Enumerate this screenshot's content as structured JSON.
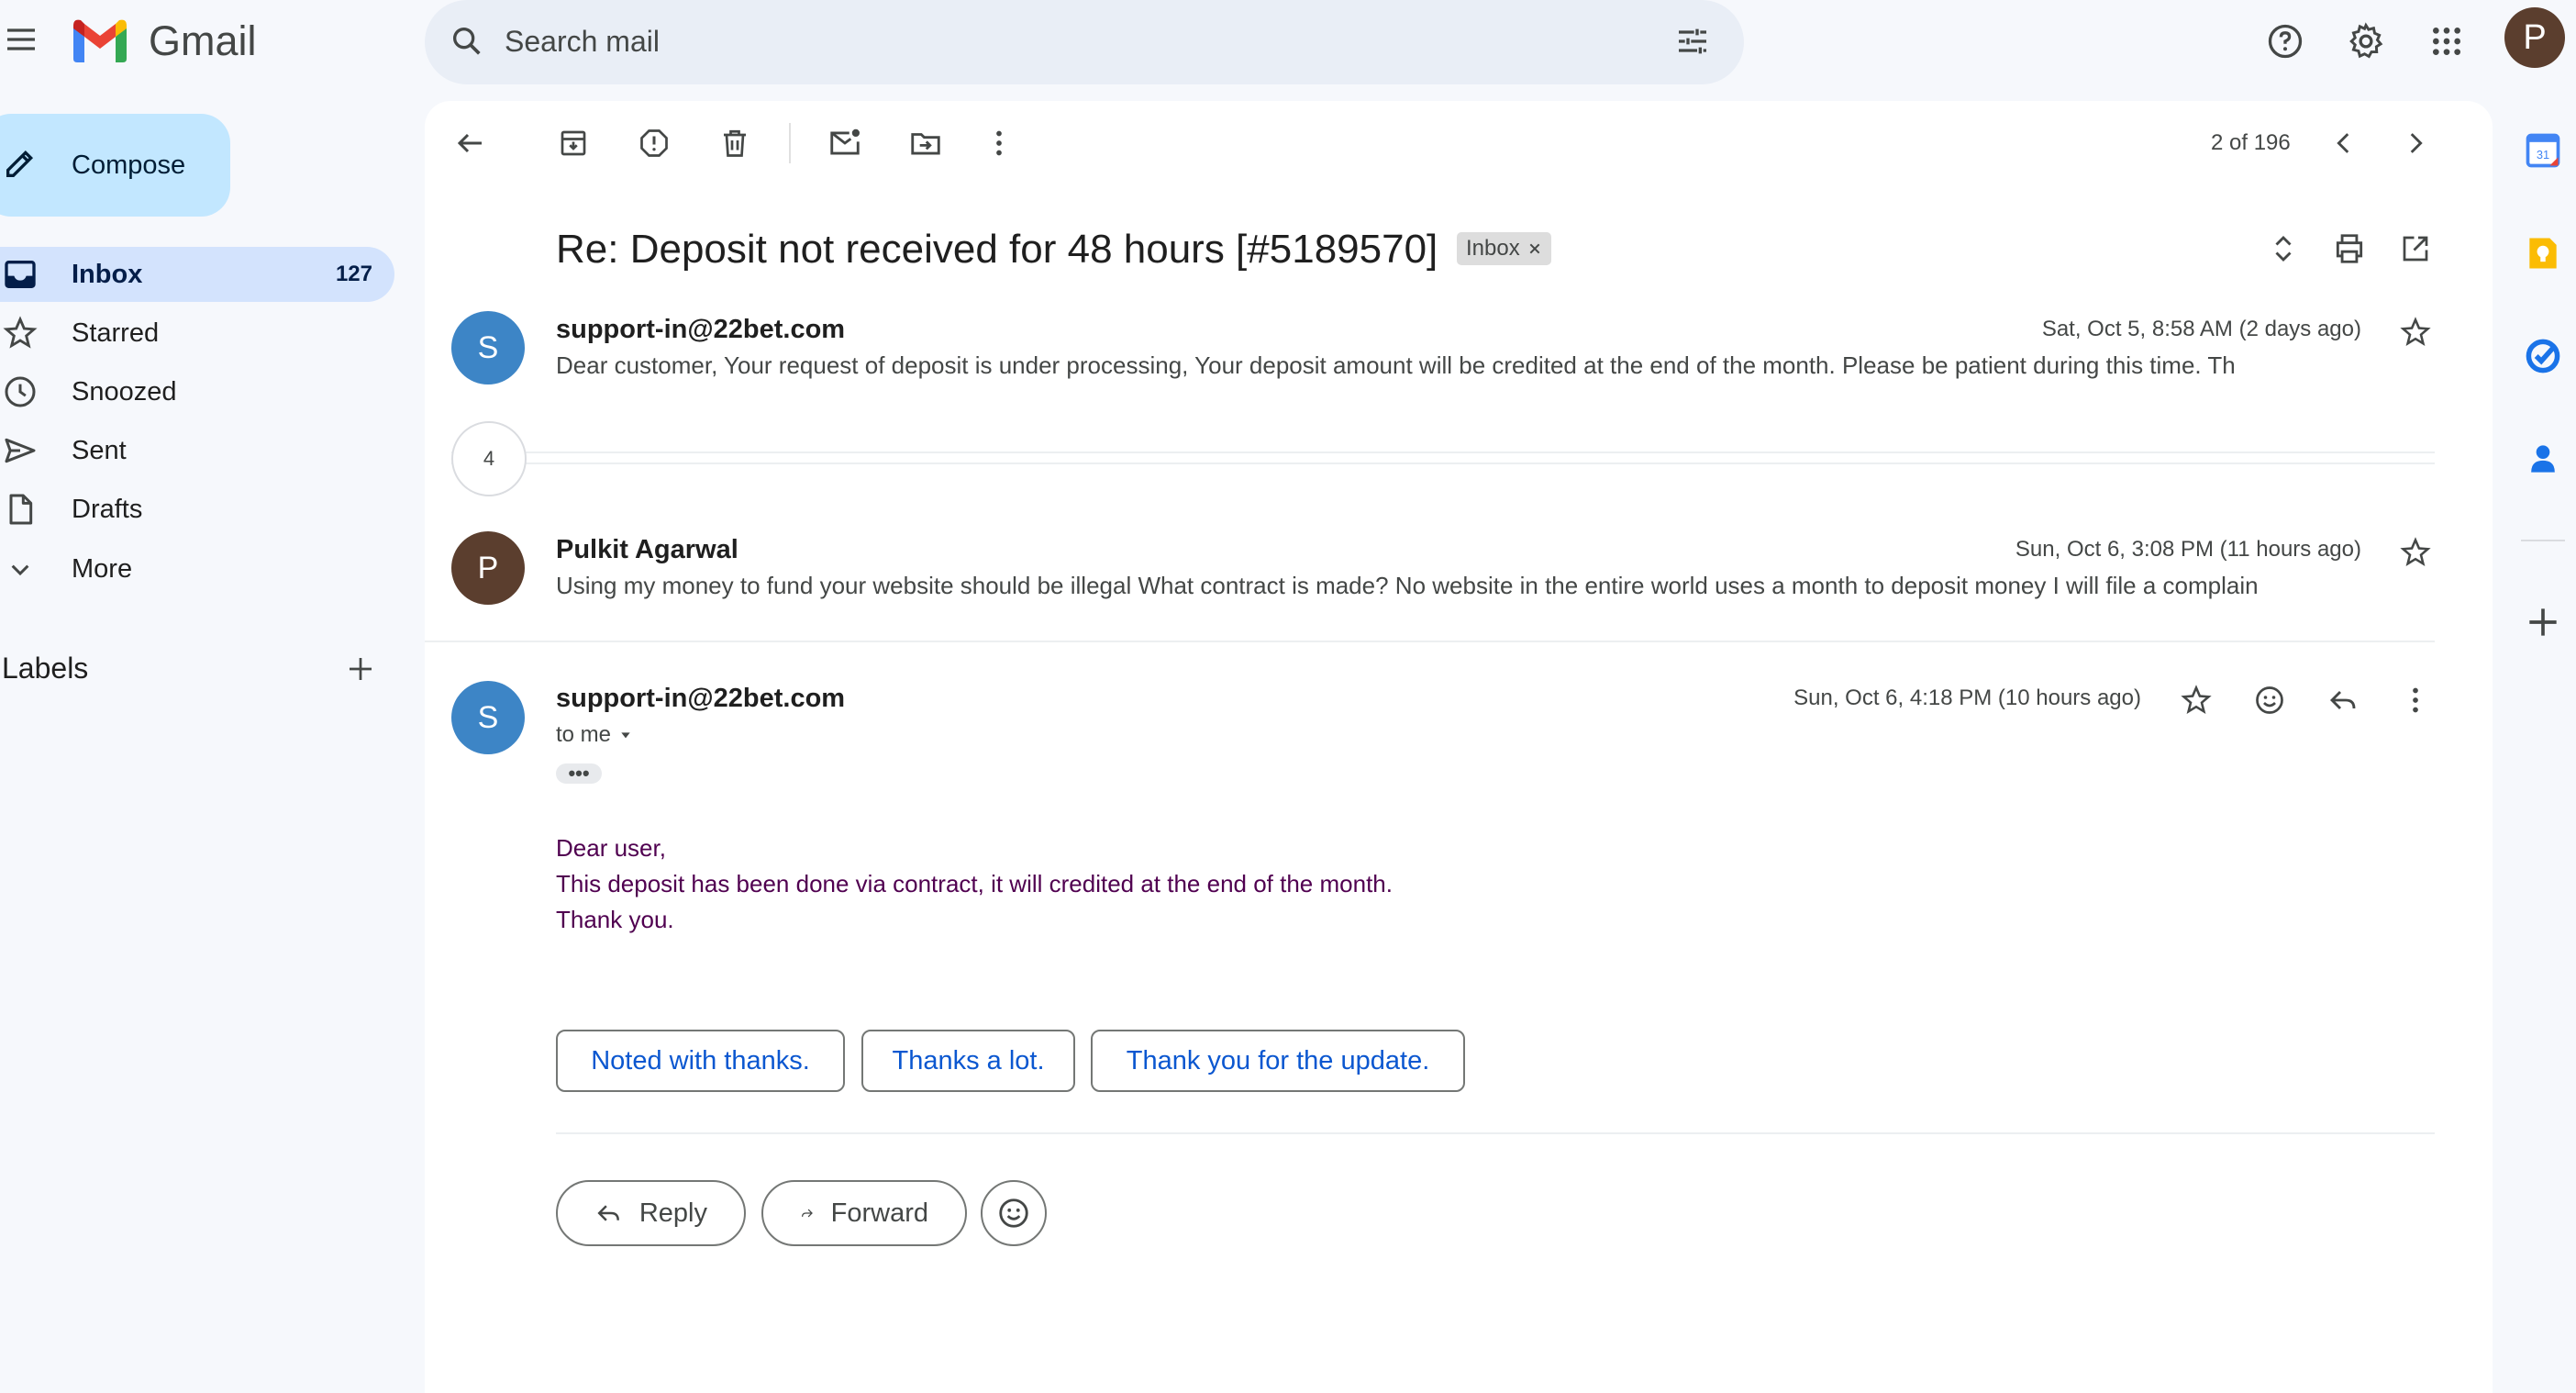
{
  "app": {
    "name": "Gmail",
    "avatar_letter": "P"
  },
  "search": {
    "placeholder": "Search mail"
  },
  "icons": {
    "menu": "hamburger-icon",
    "search": "search-icon",
    "filter": "tune-icon",
    "help": "help-icon",
    "settings": "gear-icon",
    "apps": "apps-grid-icon",
    "compose": "pencil-icon",
    "back": "arrow-back-icon",
    "archive": "archive-icon",
    "report": "report-spam-icon",
    "delete": "trash-icon",
    "mark_unread": "mark-unread-icon",
    "move": "move-to-icon",
    "more": "more-vert-icon",
    "prev": "chevron-left-icon",
    "next": "chevron-right-icon",
    "expand": "unfold-icon",
    "print": "print-icon",
    "open_new": "open-in-new-icon",
    "star": "star-icon",
    "emoji": "emoji-icon",
    "reply": "reply-icon",
    "forward": "forward-icon",
    "rail": [
      "calendar-icon",
      "keep-icon",
      "tasks-icon",
      "contacts-icon",
      "add-icon"
    ]
  },
  "colors": {
    "brand_red": "#ea4335",
    "compose_bg": "#c2e7ff",
    "nav_active": "#d3e3fd",
    "link_blue": "#0b57d0",
    "quoted_purple": "#500050"
  },
  "sidebar": {
    "compose_label": "Compose",
    "items": [
      {
        "label": "Inbox",
        "count": "127",
        "icon": "inbox-icon"
      },
      {
        "label": "Starred",
        "count": "",
        "icon": "star-icon"
      },
      {
        "label": "Snoozed",
        "count": "",
        "icon": "clock-icon"
      },
      {
        "label": "Sent",
        "count": "",
        "icon": "send-icon"
      },
      {
        "label": "Drafts",
        "count": "",
        "icon": "draft-icon"
      },
      {
        "label": "More",
        "count": "",
        "icon": "chevron-down-icon"
      }
    ],
    "labels_title": "Labels"
  },
  "toolbar": {
    "pager": "2 of 196"
  },
  "thread": {
    "subject": "Re: Deposit not received for 48 hours [#5189570]",
    "label_chip": "Inbox",
    "collapsed_count": "4",
    "messages": [
      {
        "avatar": "S",
        "avatar_color": "#3d85c6",
        "sender": "support-in@22bet.com",
        "date": "Sat, Oct 5, 8:58 AM (2 days ago)",
        "snippet": "Dear customer, Your request of deposit is under processing, Your deposit amount will be credited at the end of the month. Please be patient during this time. Th"
      },
      {
        "avatar": "P",
        "avatar_color": "#5b3e2e",
        "sender": "Pulkit Agarwal",
        "date": "Sun, Oct 6, 3:08 PM (11 hours ago)",
        "snippet": "Using my money to fund your website should be illegal What contract is made? No website in the entire world uses a month to deposit money I will file a complain"
      },
      {
        "avatar": "S",
        "avatar_color": "#3d85c6",
        "sender": "support-in@22bet.com",
        "date": "Sun, Oct 6, 4:18 PM (10 hours ago)",
        "to_line": "to me",
        "ellipsis": "•••",
        "body": [
          "Dear user,",
          "This deposit has been done via contract, it will credited at the end of the month.",
          "Thank you."
        ]
      }
    ],
    "smart_replies": [
      "Noted with thanks.",
      "Thanks a lot.",
      "Thank you for the update."
    ],
    "actions": {
      "reply": "Reply",
      "forward": "Forward"
    }
  }
}
